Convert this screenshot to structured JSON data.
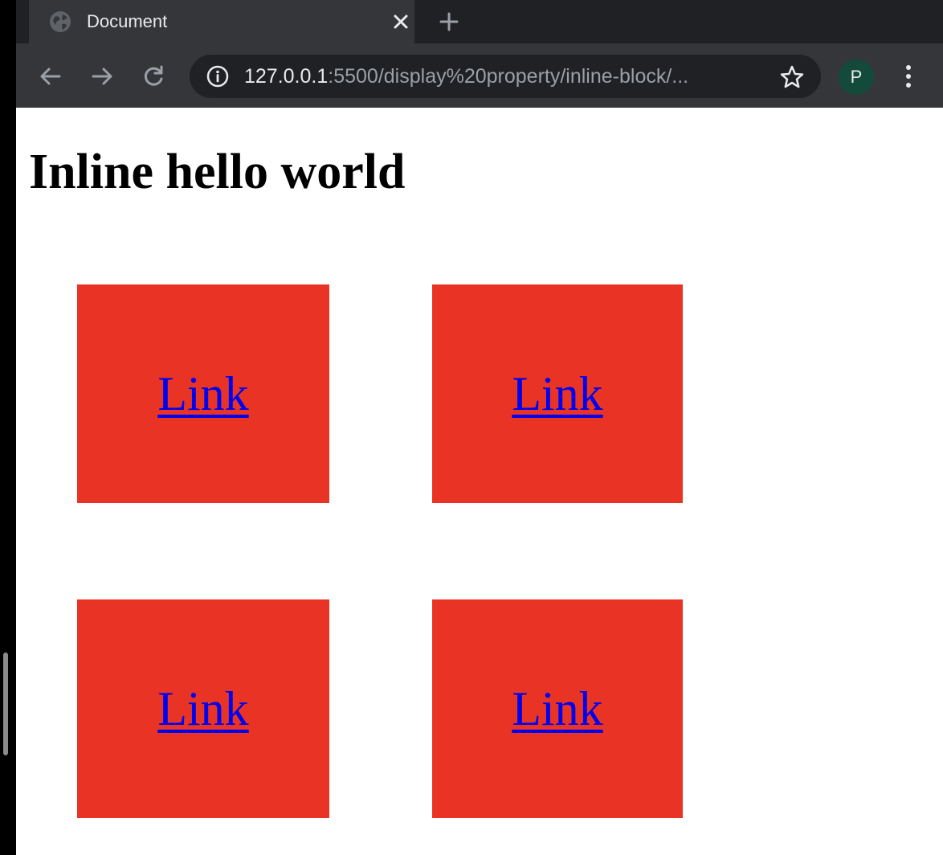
{
  "browser": {
    "tab": {
      "title": "Document",
      "favicon": "globe-icon"
    },
    "new_tab_icon": "plus-icon",
    "toolbar": {
      "back_icon": "arrow-left-icon",
      "forward_icon": "arrow-right-icon",
      "reload_icon": "reload-icon",
      "url_host": "127.0.0.1",
      "url_path": ":5500/display%20property/inline-block/...",
      "info_icon": "info-icon",
      "bookmark_icon": "star-icon",
      "profile_initial": "P",
      "menu_icon": "kebab-menu-icon"
    }
  },
  "page": {
    "heading": "Inline hello world",
    "boxes": [
      {
        "link": "Link"
      },
      {
        "link": "Link"
      },
      {
        "link": "Link"
      },
      {
        "link": "Link"
      }
    ]
  },
  "colors": {
    "box_background": "#e93425",
    "link": "#0000ee",
    "tabstrip": "#202124",
    "toolbar": "#35363a",
    "avatar": "#134a3a"
  }
}
